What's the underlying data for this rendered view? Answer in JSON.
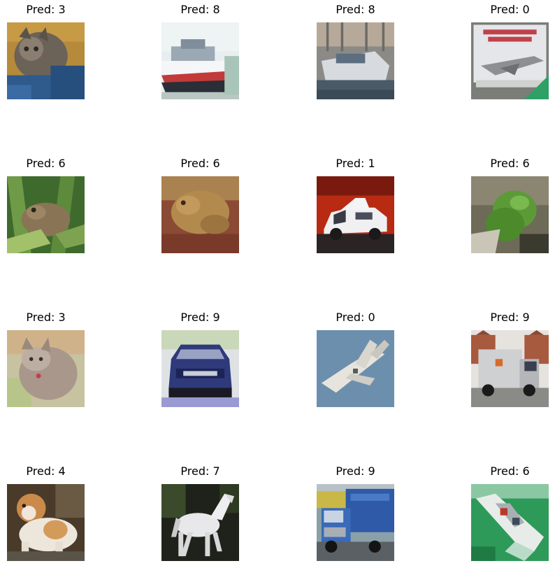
{
  "images": [
    {
      "title": "Pred: 3",
      "subject": "cat"
    },
    {
      "title": "Pred: 8",
      "subject": "ship"
    },
    {
      "title": "Pred: 8",
      "subject": "ship"
    },
    {
      "title": "Pred: 0",
      "subject": "airplane"
    },
    {
      "title": "Pred: 6",
      "subject": "frog"
    },
    {
      "title": "Pred: 6",
      "subject": "frog"
    },
    {
      "title": "Pred: 1",
      "subject": "automobile"
    },
    {
      "title": "Pred: 6",
      "subject": "frog"
    },
    {
      "title": "Pred: 3",
      "subject": "cat"
    },
    {
      "title": "Pred: 9",
      "subject": "truck"
    },
    {
      "title": "Pred: 0",
      "subject": "airplane"
    },
    {
      "title": "Pred: 9",
      "subject": "truck"
    },
    {
      "title": "Pred: 4",
      "subject": "dog"
    },
    {
      "title": "Pred: 7",
      "subject": "horse"
    },
    {
      "title": "Pred: 9",
      "subject": "truck"
    },
    {
      "title": "Pred: 6",
      "subject": "ship"
    }
  ]
}
